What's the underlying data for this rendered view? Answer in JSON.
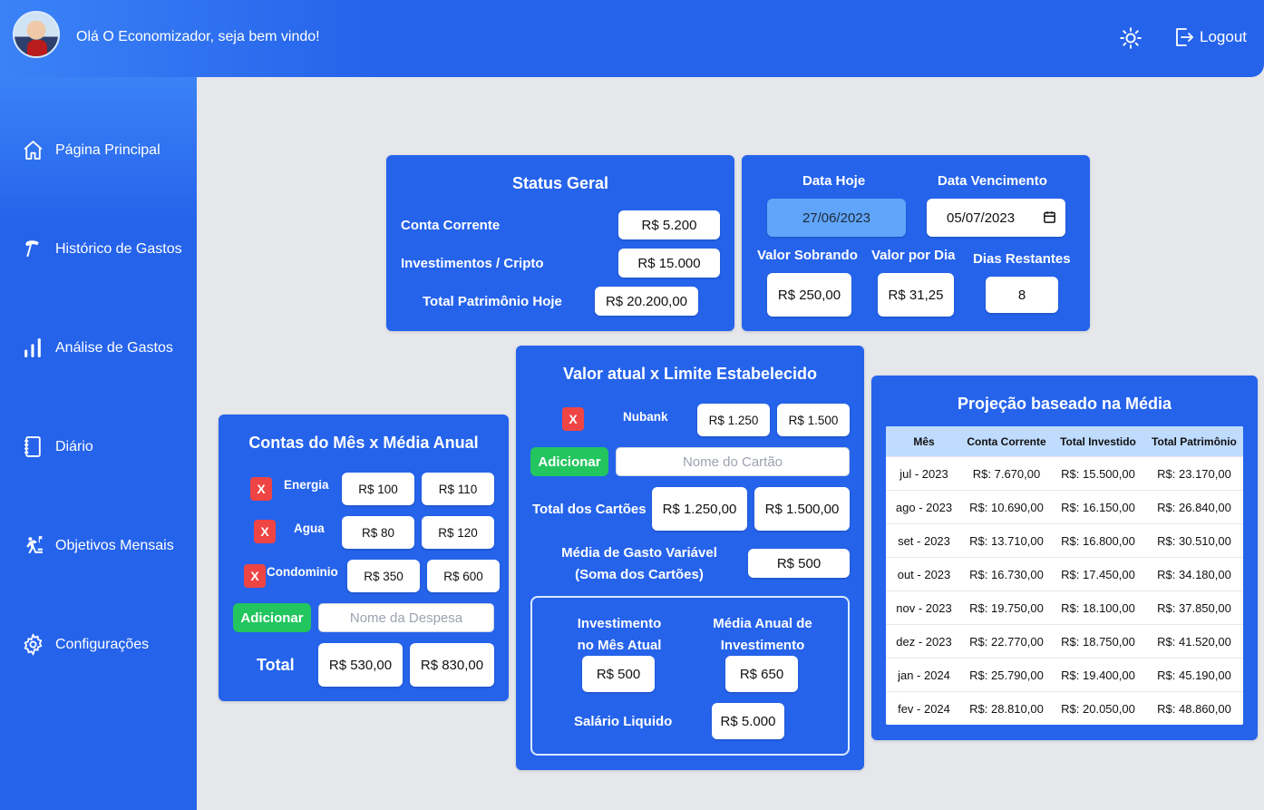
{
  "header": {
    "welcome": "Olá O Economizador, seja bem vindo!",
    "logout_label": "Logout"
  },
  "sidebar": {
    "items": [
      {
        "label": "Página Principal",
        "icon": "home-icon"
      },
      {
        "label": "Histórico de Gastos",
        "icon": "history-icon"
      },
      {
        "label": "Análise de Gastos",
        "icon": "bar-chart-icon"
      },
      {
        "label": "Diário",
        "icon": "notebook-icon"
      },
      {
        "label": "Objetivos Mensais",
        "icon": "goal-icon"
      },
      {
        "label": "Configurações",
        "icon": "gear-icon"
      }
    ]
  },
  "status": {
    "title": "Status Geral",
    "conta_label": "Conta Corrente",
    "conta_value": "R$ 5.200",
    "invest_label": "Investimentos / Cripto",
    "invest_value": "R$ 15.000",
    "total_label": "Total Patrimônio Hoje",
    "total_value": "R$ 20.200,00"
  },
  "datas": {
    "hoje_label": "Data Hoje",
    "hoje_value": "27/06/2023",
    "venc_label": "Data Vencimento",
    "venc_value": "05/07/2023",
    "sobrando_label": "Valor Sobrando",
    "sobrando_value": "R$ 250,00",
    "dia_label": "Valor por Dia",
    "dia_value": "R$ 31,25",
    "restantes_label": "Dias Restantes",
    "restantes_value": "8"
  },
  "contas": {
    "title": "Contas do Mês x Média Anual",
    "items": [
      {
        "remove": "X",
        "name": "Energia",
        "atual": "R$ 100",
        "media": "R$ 110"
      },
      {
        "remove": "X",
        "name": "Agua",
        "atual": "R$ 80",
        "media": "R$ 120"
      },
      {
        "remove": "X",
        "name": "Condominio",
        "atual": "R$ 350",
        "media": "R$ 600"
      }
    ],
    "add_label": "Adicionar",
    "input_placeholder": "Nome da Despesa",
    "total_label": "Total",
    "total_atual": "R$ 530,00",
    "total_media": "R$ 830,00"
  },
  "limite": {
    "title": "Valor atual x Limite Estabelecido",
    "cards": [
      {
        "remove": "X",
        "name": "Nubank",
        "atual": "R$ 1.250",
        "limite": "R$ 1.500"
      }
    ],
    "add_label": "Adicionar",
    "input_placeholder": "Nome do Cartão",
    "total_label": "Total dos Cartões",
    "total_atual": "R$ 1.250,00",
    "total_limite": "R$ 1.500,00",
    "media_label_1": "Média de Gasto Variável",
    "media_label_2": "(Soma dos Cartões)",
    "media_value": "R$ 500",
    "invest_label_1": "Investimento",
    "invest_label_2": "no Mês Atual",
    "invest_value": "R$ 500",
    "media_invest_label_1": "Média Anual de",
    "media_invest_label_2": "Investimento",
    "media_invest_value": "R$ 650",
    "salario_label": "Salário Liquido",
    "salario_value": "R$ 5.000"
  },
  "projecao": {
    "title": "Projeção baseado na Média",
    "columns": [
      "Mês",
      "Conta Corrente",
      "Total Investido",
      "Total Patrimônio"
    ],
    "rows": [
      [
        "jul - 2023",
        "R$: 7.670,00",
        "R$: 15.500,00",
        "R$: 23.170,00"
      ],
      [
        "ago - 2023",
        "R$: 10.690,00",
        "R$: 16.150,00",
        "R$: 26.840,00"
      ],
      [
        "set - 2023",
        "R$: 13.710,00",
        "R$: 16.800,00",
        "R$: 30.510,00"
      ],
      [
        "out - 2023",
        "R$: 16.730,00",
        "R$: 17.450,00",
        "R$: 34.180,00"
      ],
      [
        "nov - 2023",
        "R$: 19.750,00",
        "R$: 18.100,00",
        "R$: 37.850,00"
      ],
      [
        "dez - 2023",
        "R$: 22.770,00",
        "R$: 18.750,00",
        "R$: 41.520,00"
      ],
      [
        "jan - 2024",
        "R$: 25.790,00",
        "R$: 19.400,00",
        "R$: 45.190,00"
      ],
      [
        "fev - 2024",
        "R$: 28.810,00",
        "R$: 20.050,00",
        "R$: 48.860,00"
      ]
    ]
  },
  "colors": {
    "primary": "#2563eb",
    "background": "#e5e7eb",
    "danger": "#ef4444",
    "success": "#22c55e",
    "table_header": "#bfdbfe"
  }
}
